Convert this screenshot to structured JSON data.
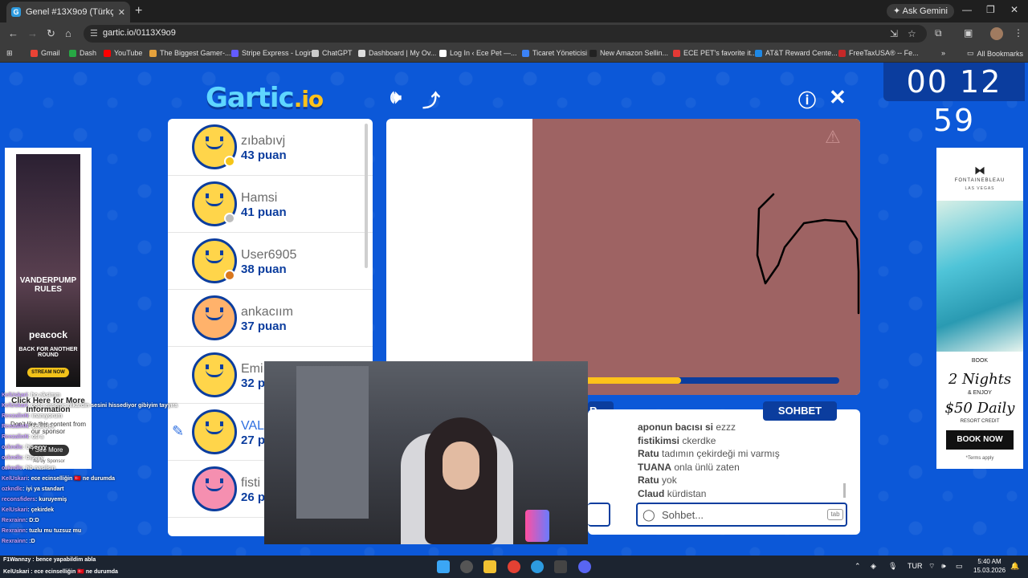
{
  "browser": {
    "tab_title": "Genel #13X9o9 (Türkçe) - Gartic",
    "tab_close": "✕",
    "new_tab": "+",
    "ask_gemini": "✦ Ask Gemini",
    "url": "gartic.io/0113X9o9",
    "bookmarks": [
      {
        "label": "Gmail",
        "color": "#ea4335"
      },
      {
        "label": "Dash",
        "color": "#27a844"
      },
      {
        "label": "YouTube",
        "color": "#ff0000"
      },
      {
        "label": "The Biggest Gamer-...",
        "color": "#e6a23c"
      },
      {
        "label": "Stripe Express - Login",
        "color": "#635bff"
      },
      {
        "label": "ChatGPT",
        "color": "#cccccc"
      },
      {
        "label": "Dashboard | My Ov...",
        "color": "#dddddd"
      },
      {
        "label": "Log In ‹ Ece Pet —...",
        "color": "#ffffff"
      },
      {
        "label": "Ticaret Yöneticisi",
        "color": "#3b82f6"
      },
      {
        "label": "New Amazon Sellin...",
        "color": "#222222"
      },
      {
        "label": "ECE PET's favorite it...",
        "color": "#e53935"
      },
      {
        "label": "AT&T Reward Cente...",
        "color": "#1e88e5"
      },
      {
        "label": "FreeTaxUSA® -- Fe...",
        "color": "#c62828"
      }
    ],
    "all_bookmarks": "All Bookmarks",
    "bookmarks_overflow": "»"
  },
  "game": {
    "logo_main": "Gartic",
    "logo_suffix": ".io",
    "timer": "00 12 59",
    "players": [
      {
        "name": "zıbabıvj",
        "score": "43 puan",
        "status_color": "#f5c518"
      },
      {
        "name": "Hamsi",
        "score": "41 puan",
        "status_color": "#bdbdbd"
      },
      {
        "name": "User6905",
        "score": "38 puan",
        "status_color": "#d9771e"
      },
      {
        "name": "ankacıım",
        "score": "37 puan",
        "status_color": ""
      },
      {
        "name": "Emi",
        "score": "32 p",
        "status_color": ""
      },
      {
        "name": "VAL",
        "score": "27 p",
        "status_color": ""
      },
      {
        "name": "fisti",
        "score": "26 p",
        "status_color": ""
      }
    ],
    "progress_fraction": 0.46,
    "chat_tab": "SOHBET",
    "answer_tab": "R",
    "chat_messages": [
      {
        "user": "aponun bacısı si",
        "text": "ezzz"
      },
      {
        "user": "fistikimsi",
        "text": "ckerdke"
      },
      {
        "user": "Ratu",
        "text": "tadımın çekirdeği mi varmış"
      },
      {
        "user": "TUANA",
        "text": "onla ünlü zaten"
      },
      {
        "user": "Ratu",
        "text": "yok"
      },
      {
        "user": "Claud",
        "text": "kürdistan"
      }
    ],
    "chat_placeholder": "Sohbet...",
    "chat_key_hint": "tab"
  },
  "ads": {
    "left": {
      "brand": "VANDERPUMP RULES",
      "network": "peacock",
      "tagline": "BACK FOR ANOTHER ROUND",
      "cta": "STREAM NOW",
      "click": "Click Here for More Information",
      "more": "Don't like this content from our sponsor",
      "see_more": "See More",
      "sponsor": "Ad by Sponsor"
    },
    "right": {
      "logo": "⧓",
      "brand": "FONTAINEBLEAU",
      "location": "LAS VEGAS",
      "book": "BOOK",
      "nights": "2 Nights",
      "enjoy": "& ENJOY",
      "daily": "$50 Daily",
      "credit": "RESORT CREDIT",
      "cta": "BOOK NOW",
      "terms": "*Terms apply"
    }
  },
  "stream_chat": [
    {
      "user": "KelUskari",
      "text": ": ho aksimm"
    },
    {
      "user": "KelUskari",
      "text": ": cece enseme nikardin sesini hissediyor gibiyim tayyıra"
    },
    {
      "user": "ReezalinN",
      "text": ": inanıyorum"
    },
    {
      "user": "ReezalinN",
      "text": ": çekirdek"
    },
    {
      "user": "ReezalinN",
      "text": ": oti a"
    },
    {
      "user": "ozkndlc",
      "text": ": bişeyyy"
    },
    {
      "user": "ozkndlc",
      "text": ": bişeyy"
    },
    {
      "user": "ozkndlc",
      "text": ": hb nasılsın"
    },
    {
      "user": "KelUskari",
      "text": ": ece ecinselliğin 🇹🇷 ne durumda"
    },
    {
      "user": "ozkndlc",
      "text": ": iyi ya standart"
    },
    {
      "user": "reconsfiders",
      "text": ": kuruyemiş"
    },
    {
      "user": "KelUskari",
      "text": ": çekirdek"
    },
    {
      "user": "Rexrainn",
      "text": ": D:D"
    },
    {
      "user": "Rexrainn",
      "text": ": tuzlu mu tuzsuz mu"
    },
    {
      "user": "Rexrainn",
      "text": ": :D"
    }
  ],
  "taskbar": {
    "msg1": "F1Wannzy : bence yapabildim abla",
    "msg2": "KelUskari : ece ecinselliğin 🇹🇷 ne durumda",
    "lang": "TUR",
    "time": "5:40 AM",
    "date": "15.03.2026"
  }
}
